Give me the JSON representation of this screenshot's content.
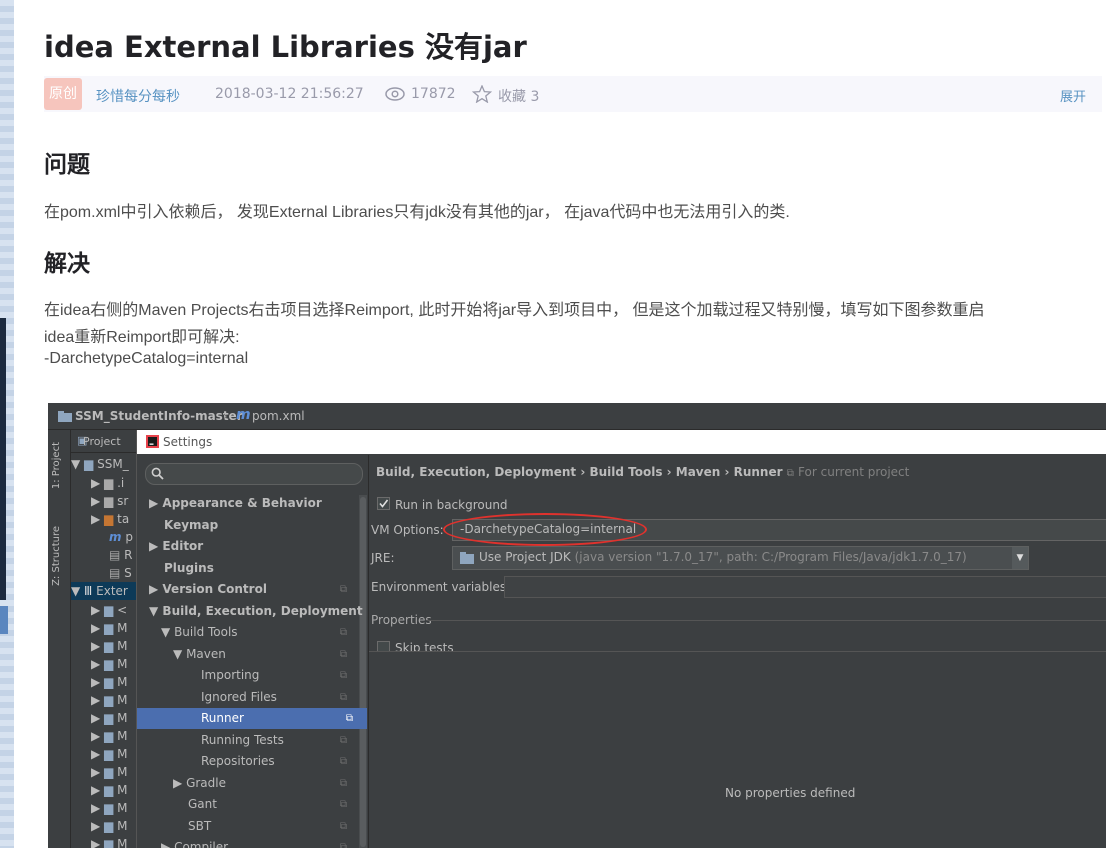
{
  "article": {
    "title": "idea External Libraries 没有jar",
    "badge": "原创",
    "author": "珍惜每分每秒",
    "date": "2018-03-12 21:56:27",
    "views": "17872",
    "favorites": "收藏 3",
    "expand": "展开",
    "section1_title": "问题",
    "section1_text": "在pom.xml中引入依赖后， 发现External Libraries只有jdk没有其他的jar， 在java代码中也无法用引入的类.",
    "section2_title": "解决",
    "section2_line1": "在idea右侧的Maven Projects右击项目选择Reimport, 此时开始将jar导入到项目中， 但是这个加载过程又特别慢，填写如下图参数重启",
    "section2_line2": "idea重新Reimport即可解决:",
    "section2_line3": "-DarchetypeCatalog=internal"
  },
  "ide": {
    "breadcrumb_project": "SSM_StudentInfo-master",
    "breadcrumb_file": "pom.xml",
    "project_tab": "Project",
    "vtab_project": "1: Project",
    "vtab_structure": "Z: Structure",
    "tree": {
      "root": "SSM_",
      "row1": ".i",
      "row2": "sr",
      "row3": "ta",
      "row4": "p",
      "row5": "R",
      "row6": "S",
      "external": "Exter",
      "row8": "<",
      "lib": "M"
    },
    "settings_title": "Settings",
    "settings_tree": [
      {
        "label": "Appearance & Behavior",
        "arrow": "▶"
      },
      {
        "label": "Keymap",
        "arrow": ""
      },
      {
        "label": "Editor",
        "arrow": "▶"
      },
      {
        "label": "Plugins",
        "arrow": ""
      },
      {
        "label": "Version Control",
        "arrow": "▶"
      },
      {
        "label": "Build, Execution, Deployment",
        "arrow": "▼"
      },
      {
        "label": "Build Tools",
        "arrow": "▼"
      },
      {
        "label": "Maven",
        "arrow": "▼"
      },
      {
        "label": "Importing",
        "arrow": ""
      },
      {
        "label": "Ignored Files",
        "arrow": ""
      },
      {
        "label": "Runner",
        "arrow": ""
      },
      {
        "label": "Running Tests",
        "arrow": ""
      },
      {
        "label": "Repositories",
        "arrow": ""
      },
      {
        "label": "Gradle",
        "arrow": "▶"
      },
      {
        "label": "Gant",
        "arrow": ""
      },
      {
        "label": "SBT",
        "arrow": ""
      },
      {
        "label": "Compiler",
        "arrow": "▶"
      }
    ],
    "crumb": "Build, Execution, Deployment › Build Tools › Maven › Runner",
    "crumb_scope": "For current project",
    "run_in_background": "Run in background",
    "vm_options_label": "VM Options:",
    "vm_options_value": "-DarchetypeCatalog=internal",
    "jre_label": "JRE:",
    "jre_value": "Use Project JDK",
    "jre_detail": "(java version \"1.7.0_17\", path: C:/Program Files/Java/jdk1.7.0_17)",
    "env_label": "Environment variables:",
    "properties_label": "Properties",
    "skip_tests": "Skip tests",
    "no_properties": "No properties defined"
  }
}
